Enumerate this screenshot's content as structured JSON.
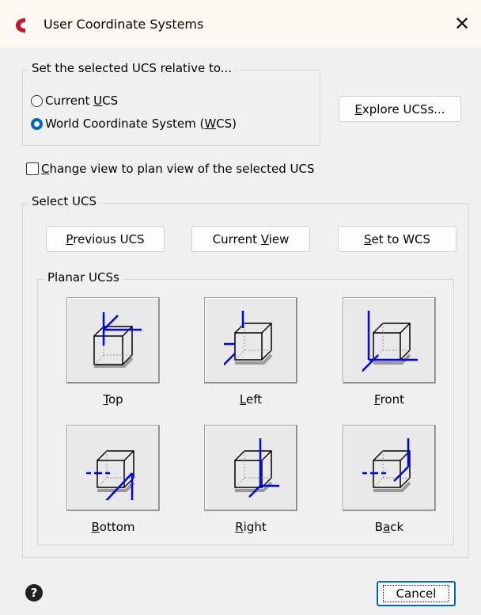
{
  "window": {
    "title": "User Coordinate Systems"
  },
  "relative_group": {
    "label": "Set the selected UCS relative to...",
    "options": [
      {
        "pre": "Current ",
        "key": "U",
        "post": "CS",
        "selected": false
      },
      {
        "pre": "World Coordinate System (",
        "key": "W",
        "post": "CS)",
        "selected": true
      }
    ],
    "explore_button": {
      "pre": "",
      "key": "E",
      "post": "xplore UCSs..."
    }
  },
  "plan_view": {
    "pre": "",
    "key": "C",
    "post": "hange view to plan view of the selected UCS",
    "checked": false
  },
  "select_ucs": {
    "label": "Select UCS",
    "buttons": [
      {
        "pre": "",
        "key": "P",
        "post": "revious UCS"
      },
      {
        "pre": "Current ",
        "key": "V",
        "post": "iew"
      },
      {
        "pre": "",
        "key": "S",
        "post": "et to WCS"
      }
    ],
    "planar": {
      "label": "Planar UCSs",
      "items": [
        {
          "pre": "",
          "key": "T",
          "post": "op"
        },
        {
          "pre": "",
          "key": "L",
          "post": "eft"
        },
        {
          "pre": "",
          "key": "F",
          "post": "ront"
        },
        {
          "pre": "",
          "key": "B",
          "post": "ottom"
        },
        {
          "pre": "",
          "key": "R",
          "post": "ight"
        },
        {
          "pre": "B",
          "key": "a",
          "post": "ck"
        }
      ]
    }
  },
  "footer": {
    "cancel_label": "Cancel",
    "help_glyph": "?"
  },
  "icons": {
    "app": "autocad-logo-icon",
    "close": "close-icon",
    "help": "help-icon"
  },
  "colors": {
    "accent": "#0067c0",
    "axis": "#0000ff",
    "app_icon": "#c8102e"
  }
}
